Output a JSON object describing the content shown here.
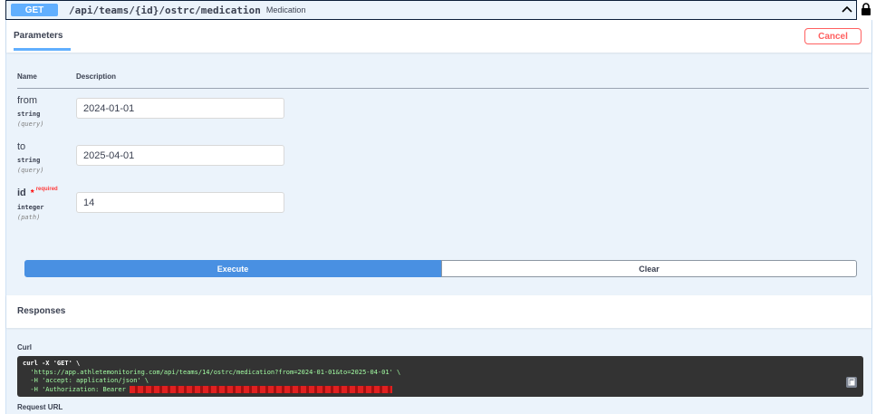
{
  "operation": {
    "method": "GET",
    "path": "/api/teams/{id}/ostrc/medication",
    "summary": "Medication"
  },
  "params_section": {
    "tab_label": "Parameters",
    "cancel_label": "Cancel",
    "col_name": "Name",
    "col_description": "Description"
  },
  "parameters": [
    {
      "name": "from",
      "type": "string",
      "in": "(query)",
      "value": "2024-01-01",
      "required": false
    },
    {
      "name": "to",
      "type": "string",
      "in": "(query)",
      "value": "2025-04-01",
      "required": false
    },
    {
      "name": "id",
      "type": "integer",
      "in": "(path)",
      "value": "14",
      "required": true,
      "required_mark": "*",
      "required_label": "required"
    }
  ],
  "actions": {
    "execute_label": "Execute",
    "clear_label": "Clear"
  },
  "responses": {
    "title": "Responses",
    "curl_label": "Curl",
    "curl_lines": [
      "curl -X 'GET' \\",
      "  'https://app.athletemonitoring.com/api/teams/14/ostrc/medication?from=2024-01-01&to=2025-04-01' \\",
      "  -H 'accept: application/json' \\",
      "  -H 'Authorization: Bearer "
    ],
    "request_url_label": "Request URL"
  },
  "colors": {
    "get_badge": "#61affe",
    "execute": "#4990e2",
    "cancel": "#ff6060",
    "panel_bg": "#ebf3fb",
    "curl_bg": "#333333",
    "redaction": "#c81c1c"
  },
  "icons": {
    "collapse": "chevron-up-icon",
    "lock": "lock-icon",
    "copy": "copy-icon"
  }
}
